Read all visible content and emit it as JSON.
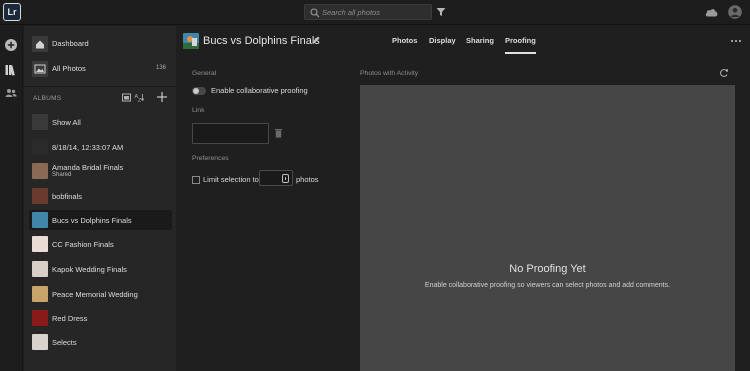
{
  "app": {
    "logo_text": "Lr"
  },
  "topbar": {
    "search_placeholder": "Search all photos",
    "icons": [
      "search-icon",
      "filter-icon",
      "cloud-icon",
      "avatar-icon"
    ]
  },
  "rail": {
    "icons": [
      "add-icon",
      "library-icon",
      "people-icon"
    ]
  },
  "sidebar": {
    "dashboard": {
      "label": "Dashboard"
    },
    "all_photos": {
      "label": "All Photos",
      "count": "136"
    },
    "albums_header": "ALBUMS",
    "albums": [
      {
        "label": "Show All",
        "sublabel": "",
        "thumb_color": "#3a3a3a"
      },
      {
        "label": "8/18/14, 12:33:07 AM",
        "sublabel": "",
        "thumb_color": "#2a2a2a"
      },
      {
        "label": "Amanda Bridal Finals",
        "sublabel": "Shared",
        "thumb_color": "#8a6a55"
      },
      {
        "label": "bobfinals",
        "sublabel": "",
        "thumb_color": "#6b3a2e"
      },
      {
        "label": "Bucs vs Dolphins Finals",
        "sublabel": "",
        "thumb_color": "#3f86a8"
      },
      {
        "label": "CC Fashion Finals",
        "sublabel": "",
        "thumb_color": "#e8dcd4"
      },
      {
        "label": "Kapok Wedding Finals",
        "sublabel": "",
        "thumb_color": "#d9cfc9"
      },
      {
        "label": "Peace Memorial Wedding",
        "sublabel": "",
        "thumb_color": "#c9a46a"
      },
      {
        "label": "Red Dress",
        "sublabel": "",
        "thumb_color": "#8a1a1a"
      },
      {
        "label": "Selects",
        "sublabel": "",
        "thumb_color": "#d8d2cc"
      }
    ],
    "selected_index": 4
  },
  "main": {
    "album_title": "Bucs vs Dolphins Finals",
    "tabs": [
      {
        "label": "Photos"
      },
      {
        "label": "Display"
      },
      {
        "label": "Sharing"
      },
      {
        "label": "Proofing"
      }
    ],
    "active_tab": "Proofing",
    "settings": {
      "general_label": "General",
      "toggle_label": "Enable collaborative proofing",
      "toggle_on": false,
      "link_label": "Link",
      "link_value": "",
      "preferences_label": "Preferences",
      "limit_label": "Limit selection to",
      "limit_value": "0",
      "photos_label": "photos"
    },
    "activity": {
      "label": "Photos with Activity",
      "empty_title": "No Proofing Yet",
      "empty_subtitle": "Enable collaborative proofing so viewers can select photos and add comments."
    }
  },
  "colors": {
    "background": "#1e1e1e",
    "sidebar": "#262626",
    "panel": "#464646",
    "selected_row": "#1a1a1a",
    "text": "#dcdcdc"
  }
}
